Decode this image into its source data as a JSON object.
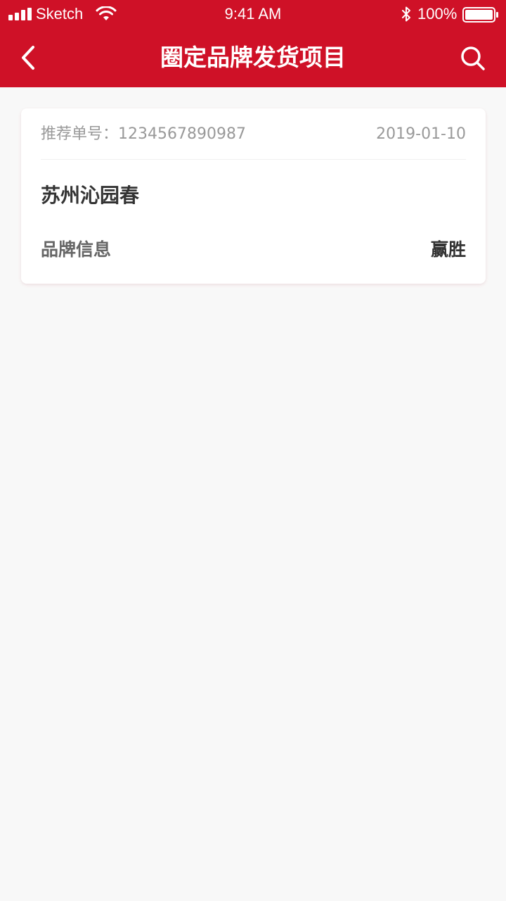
{
  "status_bar": {
    "carrier": "Sketch",
    "time": "9:41 AM",
    "battery_percent": "100%",
    "icons": [
      "signal-icon",
      "wifi-icon",
      "bluetooth-icon",
      "battery-icon"
    ]
  },
  "nav": {
    "title": "圈定品牌发货项目",
    "back_icon": "chevron-left-icon",
    "search_icon": "search-icon"
  },
  "colors": {
    "brand": "#cf1127",
    "background": "#f8f8f8",
    "card": "#ffffff",
    "text_primary": "#333333",
    "text_secondary": "#666666",
    "text_muted": "#999999"
  },
  "projects": [
    {
      "order_label": "推荐单号：",
      "order_number": "1234567890987",
      "date": "2019-01-10",
      "name": "苏州沁园春",
      "brand_label": "品牌信息",
      "brand_value": "赢胜"
    }
  ]
}
